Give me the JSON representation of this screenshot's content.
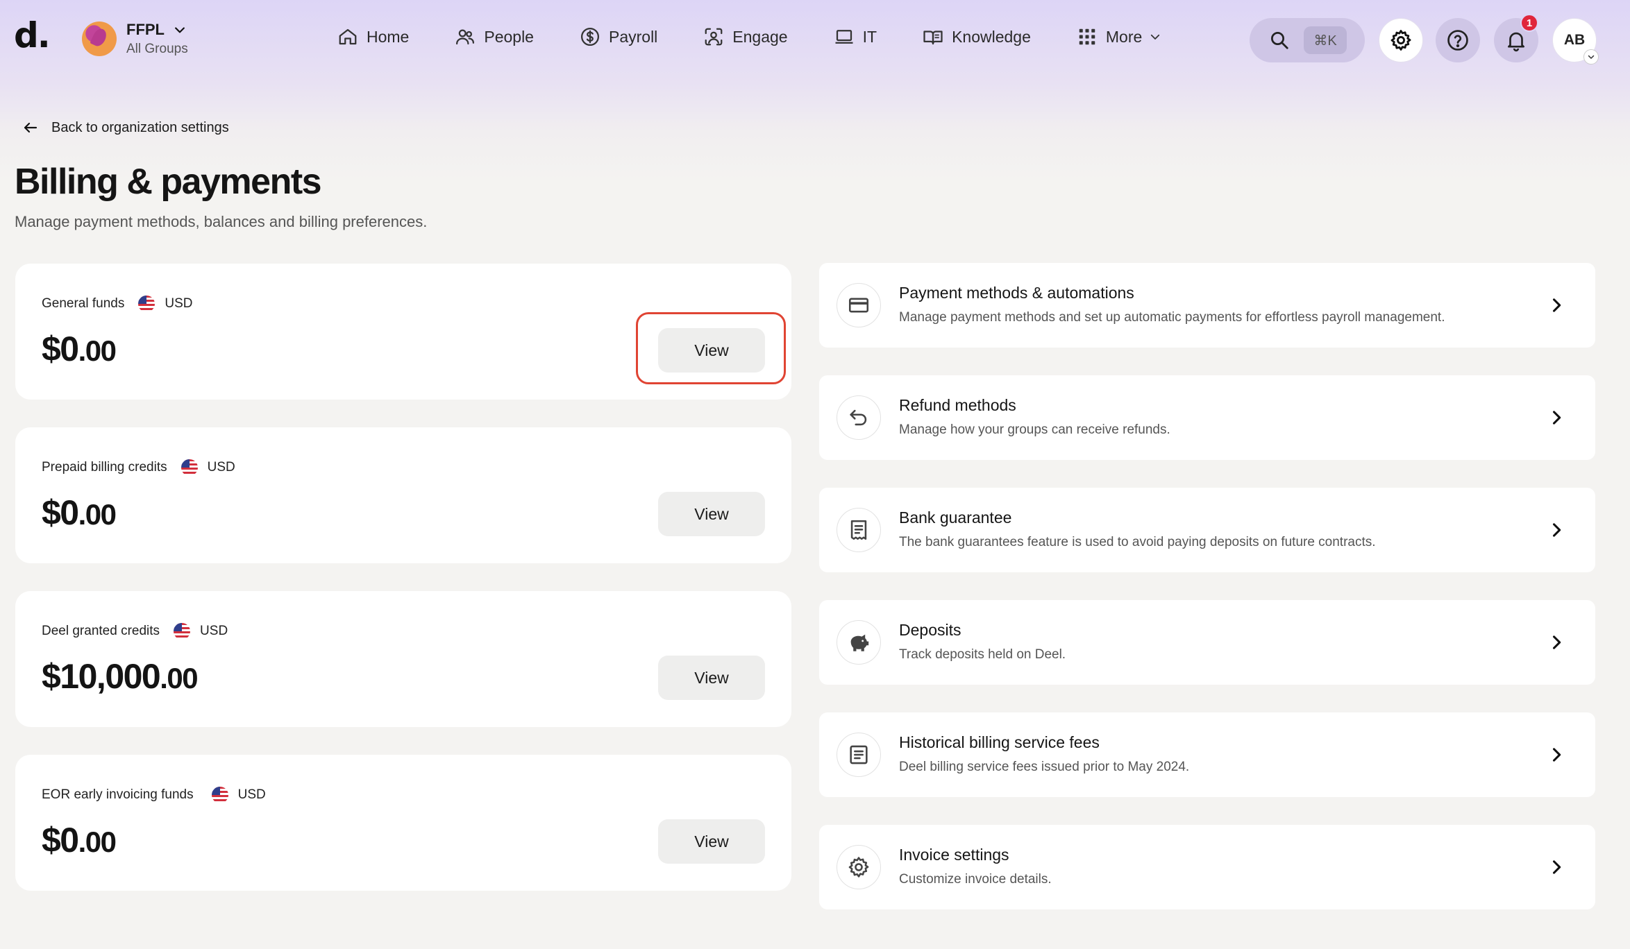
{
  "brand": {
    "logo_text": "d."
  },
  "org": {
    "name": "FFPL",
    "subtitle": "All Groups"
  },
  "nav": {
    "items": [
      {
        "label": "Home",
        "icon": "home-icon"
      },
      {
        "label": "People",
        "icon": "people-icon"
      },
      {
        "label": "Payroll",
        "icon": "dollar-circle-icon"
      },
      {
        "label": "Engage",
        "icon": "engage-icon"
      },
      {
        "label": "IT",
        "icon": "laptop-icon"
      },
      {
        "label": "Knowledge",
        "icon": "book-icon"
      },
      {
        "label": "More",
        "icon": "grid-icon"
      }
    ]
  },
  "search": {
    "shortcut": "⌘K"
  },
  "notifications": {
    "count": "1"
  },
  "user": {
    "initials": "AB"
  },
  "page": {
    "back_label": "Back to organization settings",
    "title": "Billing & payments",
    "subtitle": "Manage payment methods, balances and billing preferences."
  },
  "balances": [
    {
      "label": "General funds",
      "currency": "USD",
      "amount_main": "$0",
      "amount_cents": ".00",
      "button": "View"
    },
    {
      "label": "Prepaid billing credits",
      "currency": "USD",
      "amount_main": "$0",
      "amount_cents": ".00",
      "button": "View"
    },
    {
      "label": "Deel granted credits",
      "currency": "USD",
      "amount_main": "$10,000",
      "amount_cents": ".00",
      "button": "View"
    },
    {
      "label": "EOR early invoicing funds",
      "currency": "USD",
      "amount_main": "$0",
      "amount_cents": ".00",
      "button": "View"
    }
  ],
  "settings": [
    {
      "title": "Payment methods & automations",
      "description": "Manage payment methods and set up automatic payments for effortless payroll management.",
      "icon": "credit-card-icon"
    },
    {
      "title": "Refund methods",
      "description": "Manage how your groups can receive refunds.",
      "icon": "undo-arrow-icon"
    },
    {
      "title": "Bank guarantee",
      "description": "The bank guarantees feature is used to avoid paying deposits on future contracts.",
      "icon": "receipt-icon"
    },
    {
      "title": "Deposits",
      "description": "Track deposits held on Deel.",
      "icon": "piggy-bank-icon"
    },
    {
      "title": "Historical billing service fees",
      "description": "Deel billing service fees issued prior to May 2024.",
      "icon": "document-icon"
    },
    {
      "title": "Invoice settings",
      "description": "Customize invoice details.",
      "icon": "gear-icon"
    }
  ],
  "colors": {
    "highlight": "#e04433",
    "nav_gradient": "#ddd5f6",
    "background": "#f4f3f1",
    "badge": "#e0263b"
  }
}
